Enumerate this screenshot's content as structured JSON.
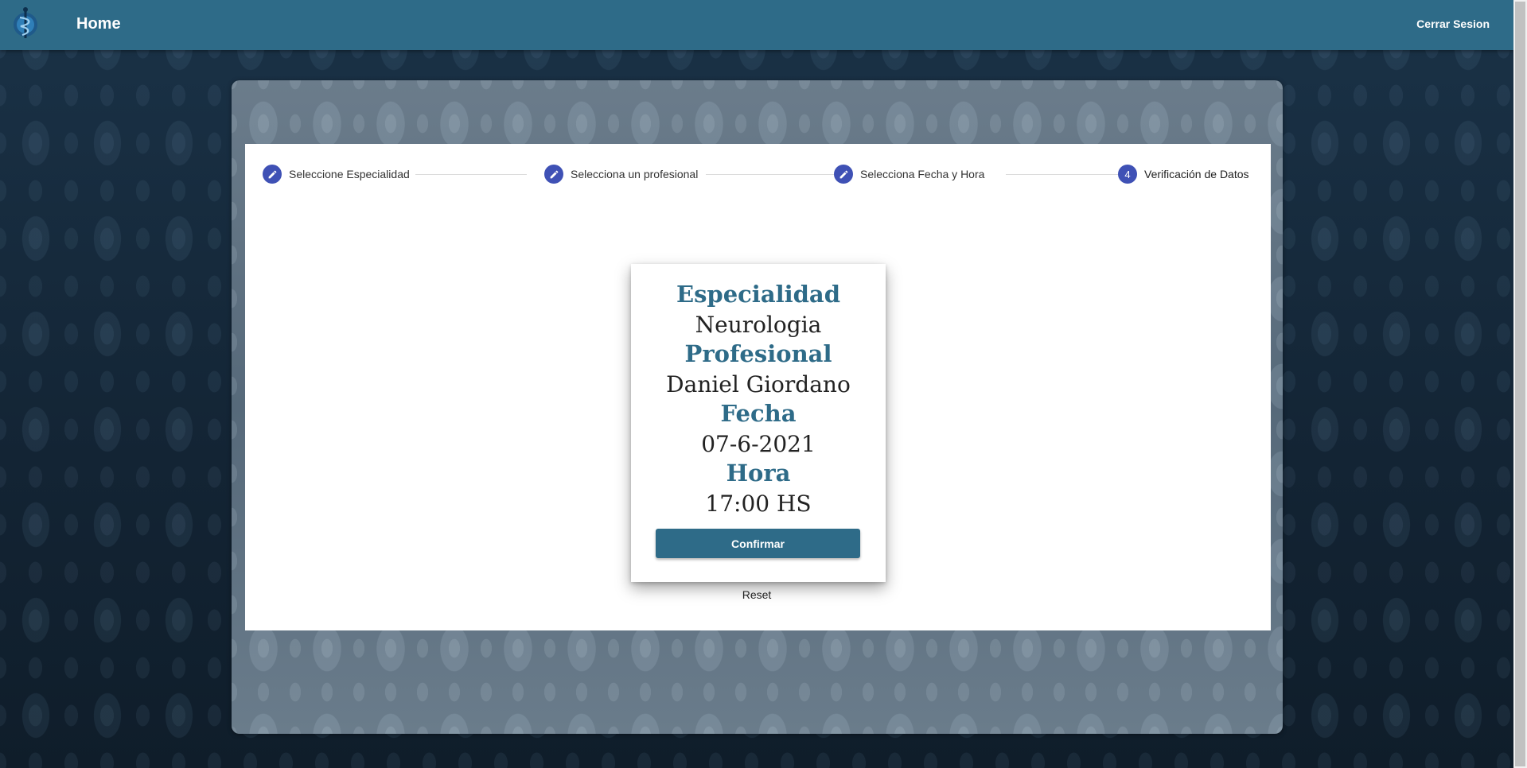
{
  "header": {
    "title": "Home",
    "logout_label": "Cerrar Sesion",
    "logo_icon": "caduceus-icon"
  },
  "colors": {
    "primary": "#2e6b88",
    "stepper_accent": "#3f51b5"
  },
  "stepper": {
    "steps": [
      {
        "label": "Seleccione Especialidad",
        "state": "edit",
        "icon": "pencil-icon"
      },
      {
        "label": "Selecciona un profesional",
        "state": "edit",
        "icon": "pencil-icon"
      },
      {
        "label": "Selecciona Fecha y Hora",
        "state": "edit",
        "icon": "pencil-icon"
      },
      {
        "label": "Verificación de Datos",
        "state": "active",
        "number": "4"
      }
    ]
  },
  "summary": {
    "specialty_label": "Especialidad",
    "specialty_value": "Neurologia",
    "professional_label": "Profesional",
    "professional_value": "Daniel Giordano",
    "date_label": "Fecha",
    "date_value": "07-6-2021",
    "time_label": "Hora",
    "time_value": "17:00 HS",
    "confirm_label": "Confirmar"
  },
  "reset_label": "Reset"
}
